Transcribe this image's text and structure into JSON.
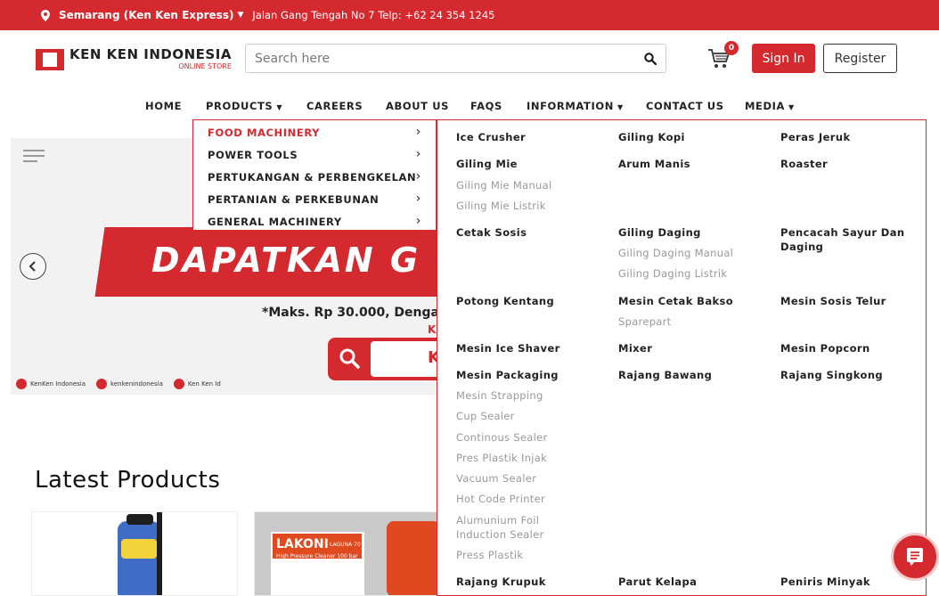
{
  "topbar": {
    "location": "Semarang (Ken Ken Express)",
    "address": "Jalan Gang Tengah No 7 Telp: +62 24 354 1245"
  },
  "header": {
    "logo_title": "KEN KEN INDONESIA",
    "logo_subtitle": "ONLINE STORE",
    "search_placeholder": "Search here",
    "cart_count": "0",
    "signin_label": "Sign In",
    "register_label": "Register"
  },
  "nav": {
    "home": "HOME",
    "products": "PRODUCTS",
    "careers": "CAREERS",
    "about": "ABOUT US",
    "faqs": "FAQS",
    "information": "INFORMATION",
    "contact": "CONTACT US",
    "media": "MEDIA"
  },
  "products_menu": [
    {
      "label": "FOOD MACHINERY",
      "active": true
    },
    {
      "label": "POWER TOOLS"
    },
    {
      "label": "PERTUKANGAN & PERBENGKELAN"
    },
    {
      "label": "PERTANIAN & PERKEBUNAN"
    },
    {
      "label": "GENERAL MACHINERY"
    }
  ],
  "mega": {
    "ice_crusher": "Ice Crusher",
    "giling_kopi": "Giling Kopi",
    "peras_jeruk": "Peras Jeruk",
    "giling_mie": "Giling Mie",
    "giling_mie_manual": "Giling Mie Manual",
    "giling_mie_listrik": "Giling Mie Listrik",
    "arum_manis": "Arum Manis",
    "roaster": "Roaster",
    "cetak_sosis": "Cetak Sosis",
    "giling_daging": "Giling Daging",
    "giling_daging_manual": "Giling Daging Manual",
    "giling_daging_listrik": "Giling Daging Listrik",
    "pencacah": "Pencacah Sayur Dan Daging",
    "potong_kentang": "Potong Kentang",
    "mesin_cetak_bakso": "Mesin Cetak Bakso",
    "sparepart": "Sparepart",
    "mesin_sosis_telur": "Mesin Sosis Telur",
    "mesin_ice_shaver": "Mesin Ice Shaver",
    "mixer": "Mixer",
    "mesin_popcorn": "Mesin Popcorn",
    "mesin_packaging": "Mesin Packaging",
    "mesin_strapping": "Mesin Strapping",
    "cup_sealer": "Cup Sealer",
    "continous_sealer": "Continous Sealer",
    "pres_plastik_injak": "Pres Plastik Injak",
    "vacuum_sealer": "Vacuum Sealer",
    "hot_code_printer": "Hot Code Printer",
    "alumunium_foil": "Alumunium Foil Induction Sealer",
    "press_plastik": "Press Plastik",
    "rajang_bawang": "Rajang Bawang",
    "rajang_singkong": "Rajang Singkong",
    "rajang_krupuk": "Rajang Krupuk",
    "parut_kelapa": "Parut Kelapa",
    "peniris_minyak": "Peniris Minyak"
  },
  "banner": {
    "headline": "DAPATKAN G",
    "subline": "*Maks. Rp 30.000, Denga",
    "subline2": "K",
    "search_letter": "K",
    "social_youtube": "KenKen Indonesia",
    "social_instagram": "kenkenindonesia",
    "social_facebook": "Ken Ken Id"
  },
  "latest_title": "Latest Products",
  "product_card_brand": "LAKONI",
  "product_card_model": "LAGUNA 70",
  "product_card_desc": "High Pressure Cleaner 100 bar",
  "colors": {
    "brand_red": "#d42a2f"
  }
}
